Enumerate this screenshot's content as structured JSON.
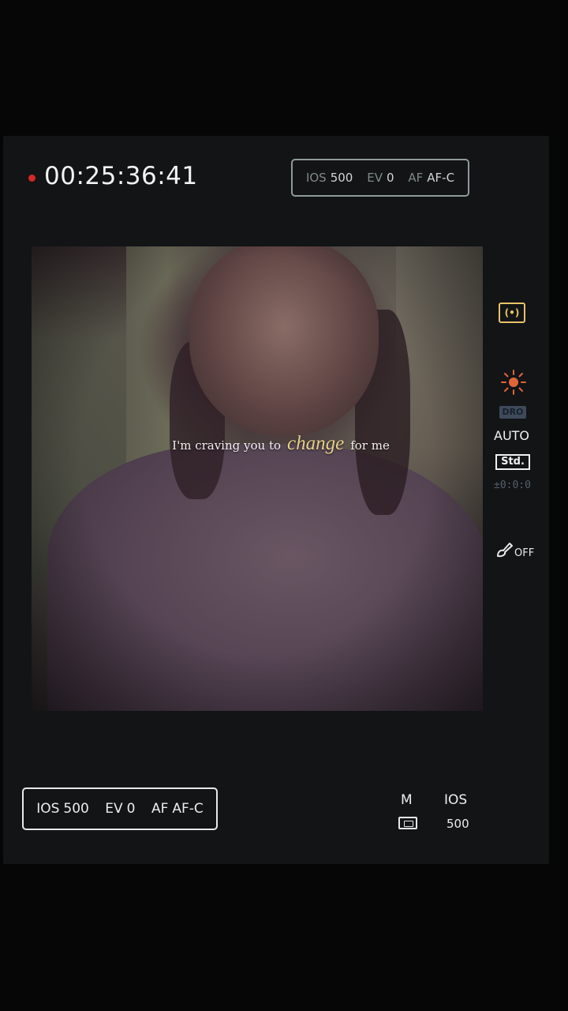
{
  "recording": {
    "timecode": "00:25:36:41"
  },
  "settings_top": {
    "iso_label": "IOS",
    "iso_value": "500",
    "ev_label": "EV",
    "ev_value": "0",
    "af_label": "AF",
    "af_value": "AF-C"
  },
  "settings_bottom": {
    "iso_label": "IOS",
    "iso_value": "500",
    "ev_label": "EV",
    "ev_value": "0",
    "af_label": "AF",
    "af_value": "AF-C"
  },
  "caption": {
    "before": "I'm craving you to",
    "accent": "change",
    "after": "for me"
  },
  "side_indicators": {
    "metering_icon": "metering-icon",
    "white_balance_icon": "sun-icon",
    "dro_label": "DRO",
    "dro_mode": "AUTO",
    "picture_style": "Std.",
    "exposure_comp": "±0:0:0",
    "retouch_label": "OFF",
    "retouch_icon": "paintbrush-icon"
  },
  "bottom_stats": {
    "mode": "M",
    "iso_label": "IOS",
    "iso_value": "500",
    "metering_icon": "metering-icon"
  },
  "colors": {
    "rec_dot": "#d42828",
    "caption_accent": "#e6cf8a",
    "metering_accent": "#e6c36a"
  }
}
